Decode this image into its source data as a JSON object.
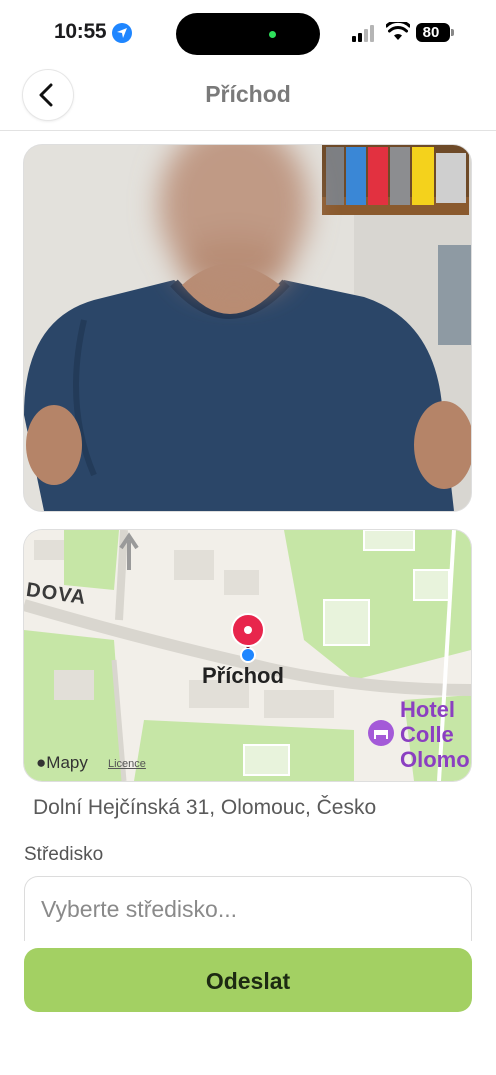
{
  "status_bar": {
    "time": "10:55",
    "battery": "80"
  },
  "header": {
    "title": "Příchod",
    "back_icon": "chevron-left-icon"
  },
  "photo": {
    "subject": "person-photo"
  },
  "map": {
    "street_label": "DOVA",
    "pin_label": "Příchod",
    "poi_lines": [
      "Hotel",
      "Colle",
      "Olomo"
    ],
    "logo_text": "Mapy",
    "licence": "Licence",
    "colors": {
      "park": "#c6e6a6",
      "road": "#d9d6cf",
      "pin": "#e8254c",
      "poi": "#8b3fc1"
    }
  },
  "address": "Dolní Hejčínská 31, Olomouc, Česko",
  "form": {
    "label": "Středisko",
    "placeholder": "Vyberte středisko...",
    "submit": "Odeslat"
  },
  "colors": {
    "accent": "#a3d063",
    "location_blue": "#1f86ff"
  }
}
